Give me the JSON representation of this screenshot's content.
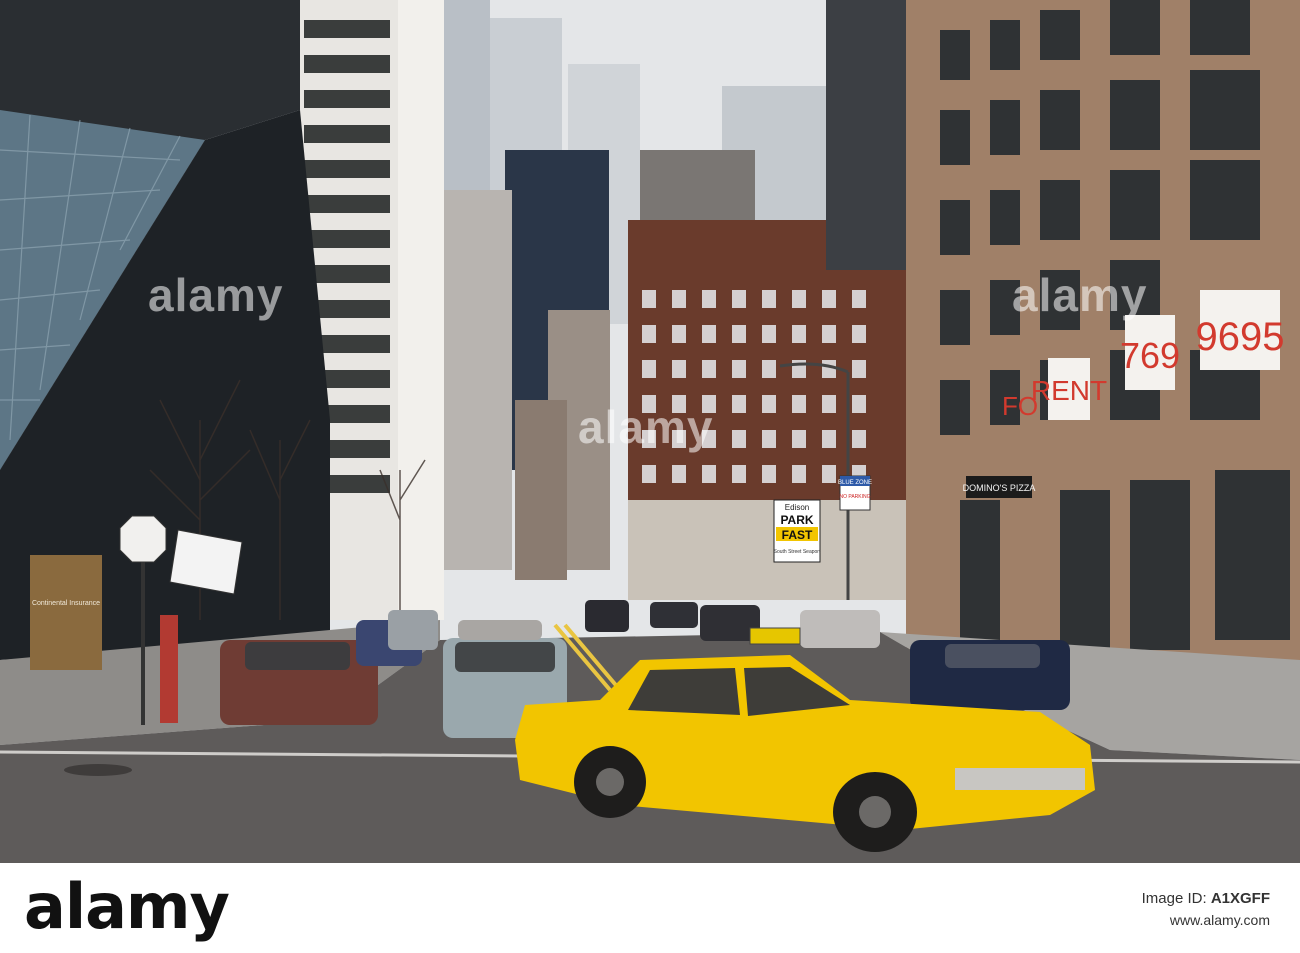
{
  "watermark": {
    "text": "alamy",
    "color": "#ffffff"
  },
  "footer": {
    "logo": "alamy",
    "image_id_label": "Image ID:",
    "image_id": "A1XGFF",
    "url": "www.alamy.com"
  },
  "scene": {
    "signs": {
      "parking_brand": "Edison",
      "parking_line1": "PARK",
      "parking_line2": "FAST",
      "parking_sub": "South Street Seaport",
      "blue_zone": "BLUE ZONE",
      "no_parking": "NO PARKING",
      "pizza": "DOMINO'S PIZZA",
      "window_for": "FO",
      "window_rent": "RENT",
      "window_num_a": "769",
      "window_num_b": "9695",
      "building_sign": "Continental Insurance"
    },
    "colors": {
      "sky": "#e4e6e8",
      "taxi": "#f2c500",
      "road": "#5e5b5a",
      "brick": "#6a3b2c",
      "tan_building": "#a08068"
    }
  }
}
